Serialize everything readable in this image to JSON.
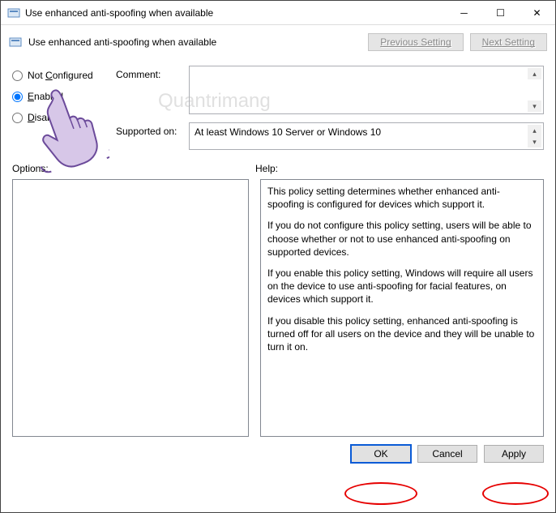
{
  "titlebar": {
    "title": "Use enhanced anti-spoofing when available"
  },
  "toolbar": {
    "label": "Use enhanced anti-spoofing when available",
    "prev": "Previous Setting",
    "next": "Next Setting"
  },
  "radios": {
    "not_conf_prefix": "Not ",
    "not_conf_u": "C",
    "not_conf_suffix": "onfigured",
    "enabled_u": "E",
    "enabled_suffix": "nabled",
    "disabled_u": "D",
    "disabled_suffix": "isabled"
  },
  "fields": {
    "comment_label": "Comment:",
    "supported_label": "Supported on:",
    "supported_value": "At least Windows 10 Server or Windows 10"
  },
  "labels": {
    "options": "Options:",
    "help": "Help:"
  },
  "help": {
    "p1": "This policy setting determines whether enhanced anti-spoofing is configured for devices which support it.",
    "p2": "If you do not configure this policy setting, users will be able to choose whether or not to use enhanced anti-spoofing on supported devices.",
    "p3": "If you enable this policy setting, Windows will require all users on the device to use anti-spoofing for facial features, on devices which support it.",
    "p4": "If you disable this policy setting, enhanced anti-spoofing is turned off for all users on the device and they will be unable to turn it on."
  },
  "footer": {
    "ok": "OK",
    "cancel": "Cancel",
    "apply": "Apply"
  },
  "watermark": "Quantrimang"
}
